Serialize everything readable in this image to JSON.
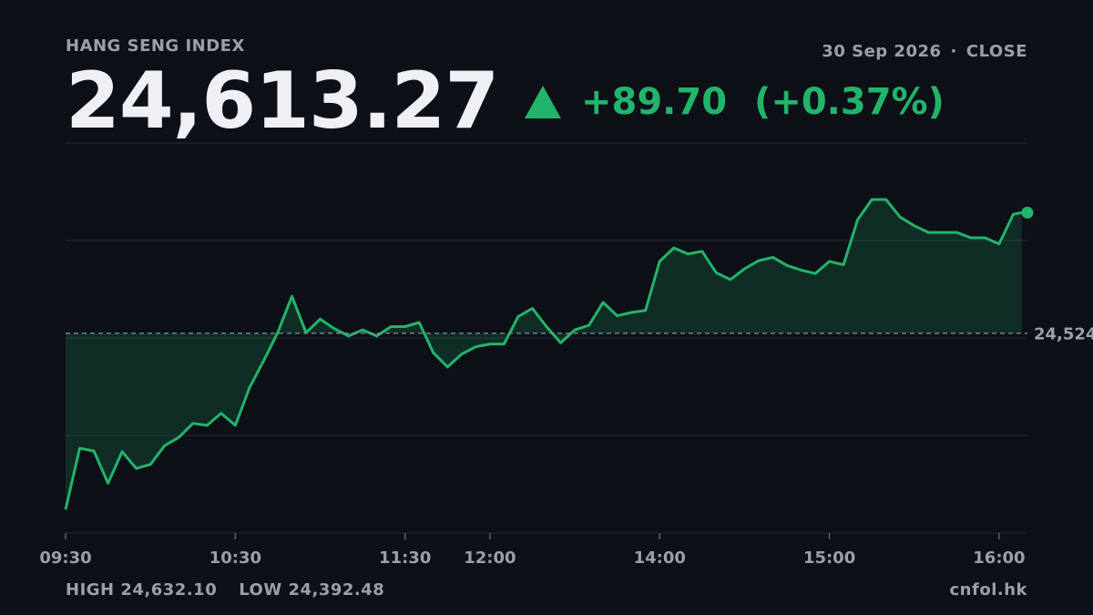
{
  "header": {
    "index_name": "HANG SENG INDEX",
    "date": "30 Sep 2026",
    "separator": "·",
    "status": "CLOSE",
    "price": "24,613.27",
    "change": "+89.70",
    "change_pct": "(+0.37%)"
  },
  "footer": {
    "high": "HIGH 24,632.10",
    "low": "LOW 24,392.48",
    "source": "cnfol.hk"
  },
  "colors": {
    "background": "#0d1017",
    "up": "#22b46b",
    "muted": "#9aa0ab",
    "grid": "#232833"
  },
  "chart_data": {
    "type": "area",
    "title": "",
    "xlabel": "",
    "ylabel": "",
    "prev_close": 24523.57,
    "prev_close_label": "24,524",
    "ylim": [
      24375,
      24665
    ],
    "x_ticks": [
      {
        "label": "09:30",
        "t": "09:30"
      },
      {
        "label": "10:30",
        "t": "10:30"
      },
      {
        "label": "11:30",
        "t": "11:30"
      },
      {
        "label": "12:00",
        "t": "13:00"
      },
      {
        "label": "14:00",
        "t": "14:00"
      },
      {
        "label": "15:00",
        "t": "15:00"
      },
      {
        "label": "16:00",
        "t": "16:00"
      }
    ],
    "session_start": "09:30",
    "session_end": "16:10",
    "series": [
      {
        "t": [
          "09:30",
          "09:35",
          "09:40",
          "09:45",
          "09:50",
          "09:55",
          "10:00",
          "10:05",
          "10:10",
          "10:15",
          "10:20",
          "10:25",
          "10:30",
          "10:35",
          "10:40",
          "10:45",
          "10:50",
          "10:55",
          "11:00",
          "11:05",
          "11:10",
          "11:15",
          "11:20",
          "11:25",
          "11:30",
          "11:35",
          "11:40",
          "11:45",
          "11:50",
          "11:55",
          "13:00",
          "13:05",
          "13:10",
          "13:15",
          "13:20",
          "13:25",
          "13:30",
          "13:35",
          "13:40",
          "13:45",
          "13:50",
          "13:55",
          "14:00",
          "14:05",
          "14:10",
          "14:15",
          "14:20",
          "14:25",
          "14:30",
          "14:35",
          "14:40",
          "14:45",
          "14:50",
          "14:55",
          "15:00",
          "15:05",
          "15:10",
          "15:15",
          "15:20",
          "15:25",
          "15:30",
          "15:35",
          "15:40",
          "15:45",
          "15:50",
          "15:55",
          "16:00",
          "16:05",
          "16:08"
        ],
        "values": [
          24392.5,
          24438.0,
          24436.0,
          24412.0,
          24435.5,
          24423.0,
          24426.0,
          24440.0,
          24446.0,
          24456.5,
          24455.0,
          24464.0,
          24455.0,
          24483.0,
          24503.0,
          24524.0,
          24551.0,
          24524.0,
          24534.0,
          24527.0,
          24521.5,
          24526.0,
          24521.5,
          24528.5,
          24528.5,
          24531.5,
          24509.0,
          24498.5,
          24508.0,
          24513.5,
          24515.5,
          24515.5,
          24536.0,
          24542.0,
          24528.5,
          24516.5,
          24526.0,
          24529.5,
          24546.5,
          24536.5,
          24539.0,
          24540.5,
          24577.0,
          24587.0,
          24582.5,
          24584.5,
          24568.5,
          24563.5,
          24571.5,
          24577.5,
          24580.0,
          24574.0,
          24570.5,
          24568.0,
          24577.0,
          24574.5,
          24608.0,
          24623.0,
          24623.0,
          24610.0,
          24603.5,
          24598.5,
          24598.5,
          24598.5,
          24594.5,
          24594.5,
          24590.0,
          24612.0,
          24613.27
        ]
      }
    ]
  }
}
